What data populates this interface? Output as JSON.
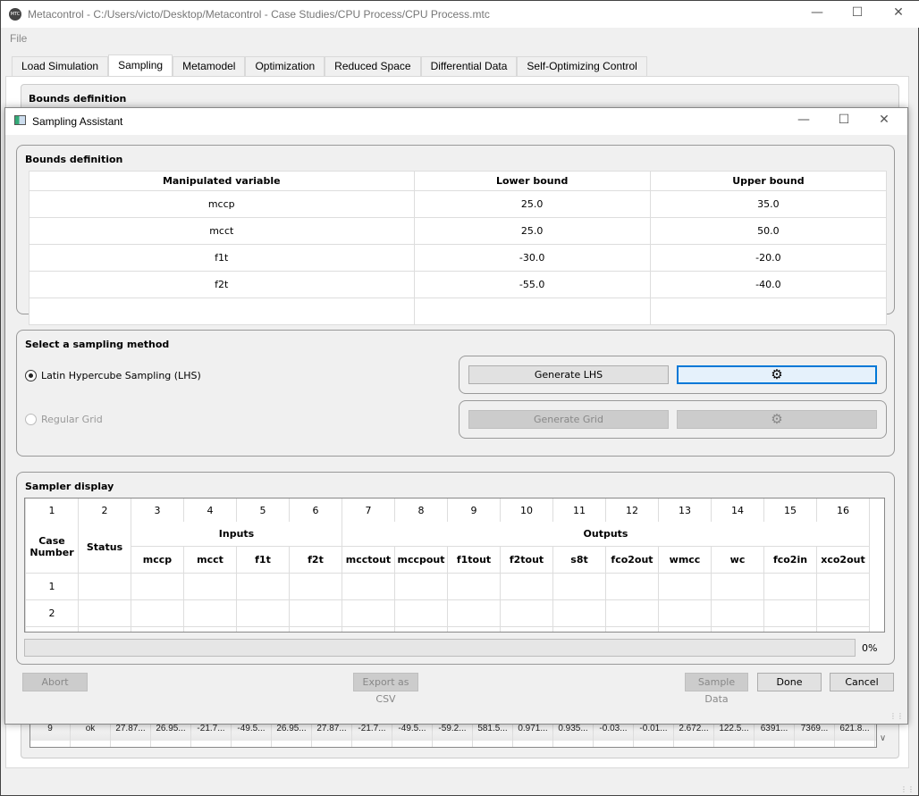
{
  "main_window": {
    "title": "Metacontrol - C:/Users/victo/Desktop/Metacontrol - Case Studies/CPU Process/CPU Process.mtc",
    "logo_text": "MTC",
    "menu": [
      "File"
    ],
    "tabs": [
      {
        "label": "Load Simulation"
      },
      {
        "label": "Sampling",
        "active": true
      },
      {
        "label": "Metamodel"
      },
      {
        "label": "Optimization"
      },
      {
        "label": "Reduced Space"
      },
      {
        "label": "Differential Data"
      },
      {
        "label": "Self-Optimizing Control"
      }
    ],
    "background_group_title": "Bounds definition",
    "background_row": [
      "9",
      "ok",
      "27.87...",
      "26.95...",
      "-21.7...",
      "-49.5...",
      "26.95...",
      "27.87...",
      "-21.7...",
      "-49.5...",
      "-59.2...",
      "581.5...",
      "0.971...",
      "0.935...",
      "-0.03...",
      "-0.01...",
      "2.672...",
      "122.5...",
      "6391...",
      "7369...",
      "621.8..."
    ]
  },
  "dialog": {
    "title": "Sampling Assistant",
    "bounds": {
      "title": "Bounds definition",
      "headers": [
        "Manipulated variable",
        "Lower bound",
        "Upper bound"
      ],
      "rows": [
        [
          "mccp",
          "25.0",
          "35.0"
        ],
        [
          "mcct",
          "25.0",
          "50.0"
        ],
        [
          "f1t",
          "-30.0",
          "-20.0"
        ],
        [
          "f2t",
          "-55.0",
          "-40.0"
        ]
      ]
    },
    "sampling": {
      "title": "Select a sampling method",
      "lhs_label": "Latin Hypercube Sampling (LHS)",
      "lhs_selected": true,
      "grid_label": "Regular Grid",
      "grid_enabled": false,
      "generate_lhs": "Generate LHS",
      "generate_grid": "Generate Grid"
    },
    "sampler": {
      "title": "Sampler display",
      "column_numbers": [
        "1",
        "2",
        "3",
        "4",
        "5",
        "6",
        "7",
        "8",
        "9",
        "10",
        "11",
        "12",
        "13",
        "14",
        "15",
        "16"
      ],
      "case_header": "Case Number",
      "status_header": "Status",
      "inputs_header": "Inputs",
      "outputs_header": "Outputs",
      "inputs": [
        "mccp",
        "mcct",
        "f1t",
        "f2t"
      ],
      "outputs": [
        "mcctout",
        "mccpout",
        "f1tout",
        "f2tout",
        "s8t",
        "fco2out",
        "wmcc",
        "wc",
        "fco2in",
        "xco2out"
      ],
      "rows": [
        "1",
        "2"
      ],
      "progress_percent": 0,
      "progress_label": "0%"
    },
    "buttons": {
      "abort": "Abort",
      "export": "Export as CSV",
      "sample": "Sample Data",
      "done": "Done",
      "cancel": "Cancel"
    },
    "accent_color": "#0078d7"
  }
}
